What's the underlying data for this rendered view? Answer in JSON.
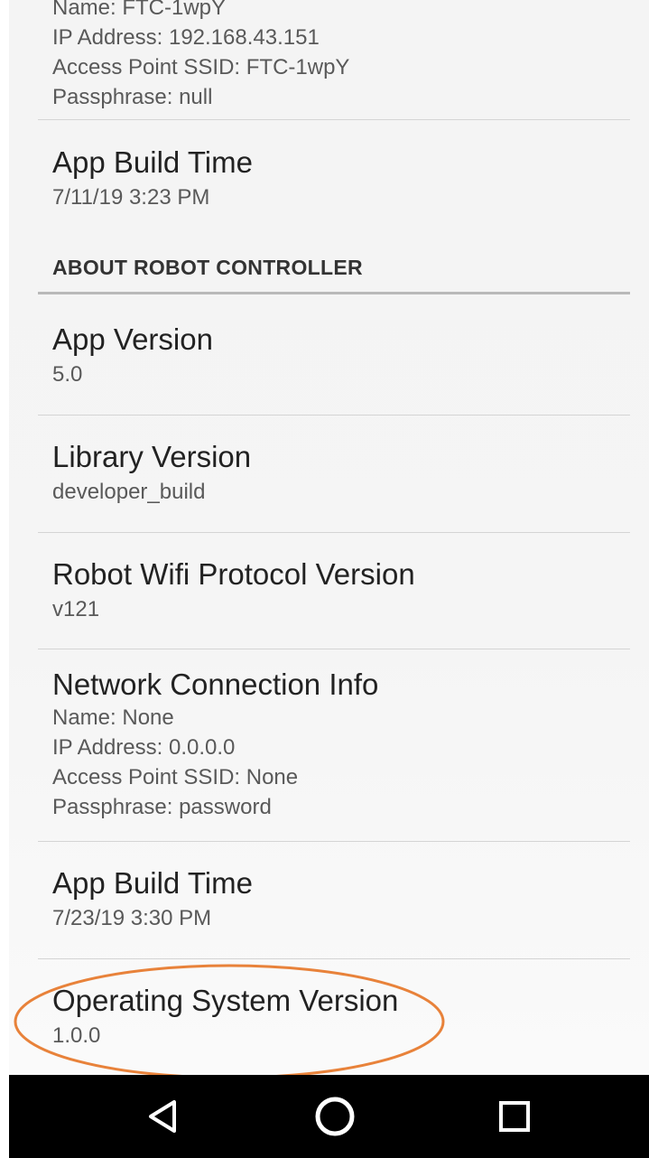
{
  "wifi_direct_info": {
    "name_partial": "Name: FTC-1wpY",
    "ip": "IP Address: 192.168.43.151",
    "ssid": "Access Point SSID: FTC-1wpY",
    "passphrase": "Passphrase: null"
  },
  "driver_station": {
    "app_build_time_title": "App Build Time",
    "app_build_time_value": "7/11/19 3:23 PM"
  },
  "robot_controller": {
    "header": "ABOUT ROBOT CONTROLLER",
    "app_version_title": "App Version",
    "app_version_value": "5.0",
    "library_version_title": "Library Version",
    "library_version_value": "developer_build",
    "wifi_protocol_title": "Robot Wifi Protocol Version",
    "wifi_protocol_value": "v121",
    "network_title": "Network Connection Info",
    "network_name": "Name: None",
    "network_ip": "IP Address: 0.0.0.0",
    "network_ssid": "Access Point SSID: None",
    "network_passphrase": "Passphrase: password",
    "app_build_time_title": "App Build Time",
    "app_build_time_value": "7/23/19 3:30 PM",
    "os_version_title": "Operating System Version",
    "os_version_value": "1.0.0"
  },
  "annotation": {
    "highlight_color": "#e8823a"
  },
  "navbar": {
    "back": "back-icon",
    "home": "home-icon",
    "recents": "recents-icon"
  }
}
